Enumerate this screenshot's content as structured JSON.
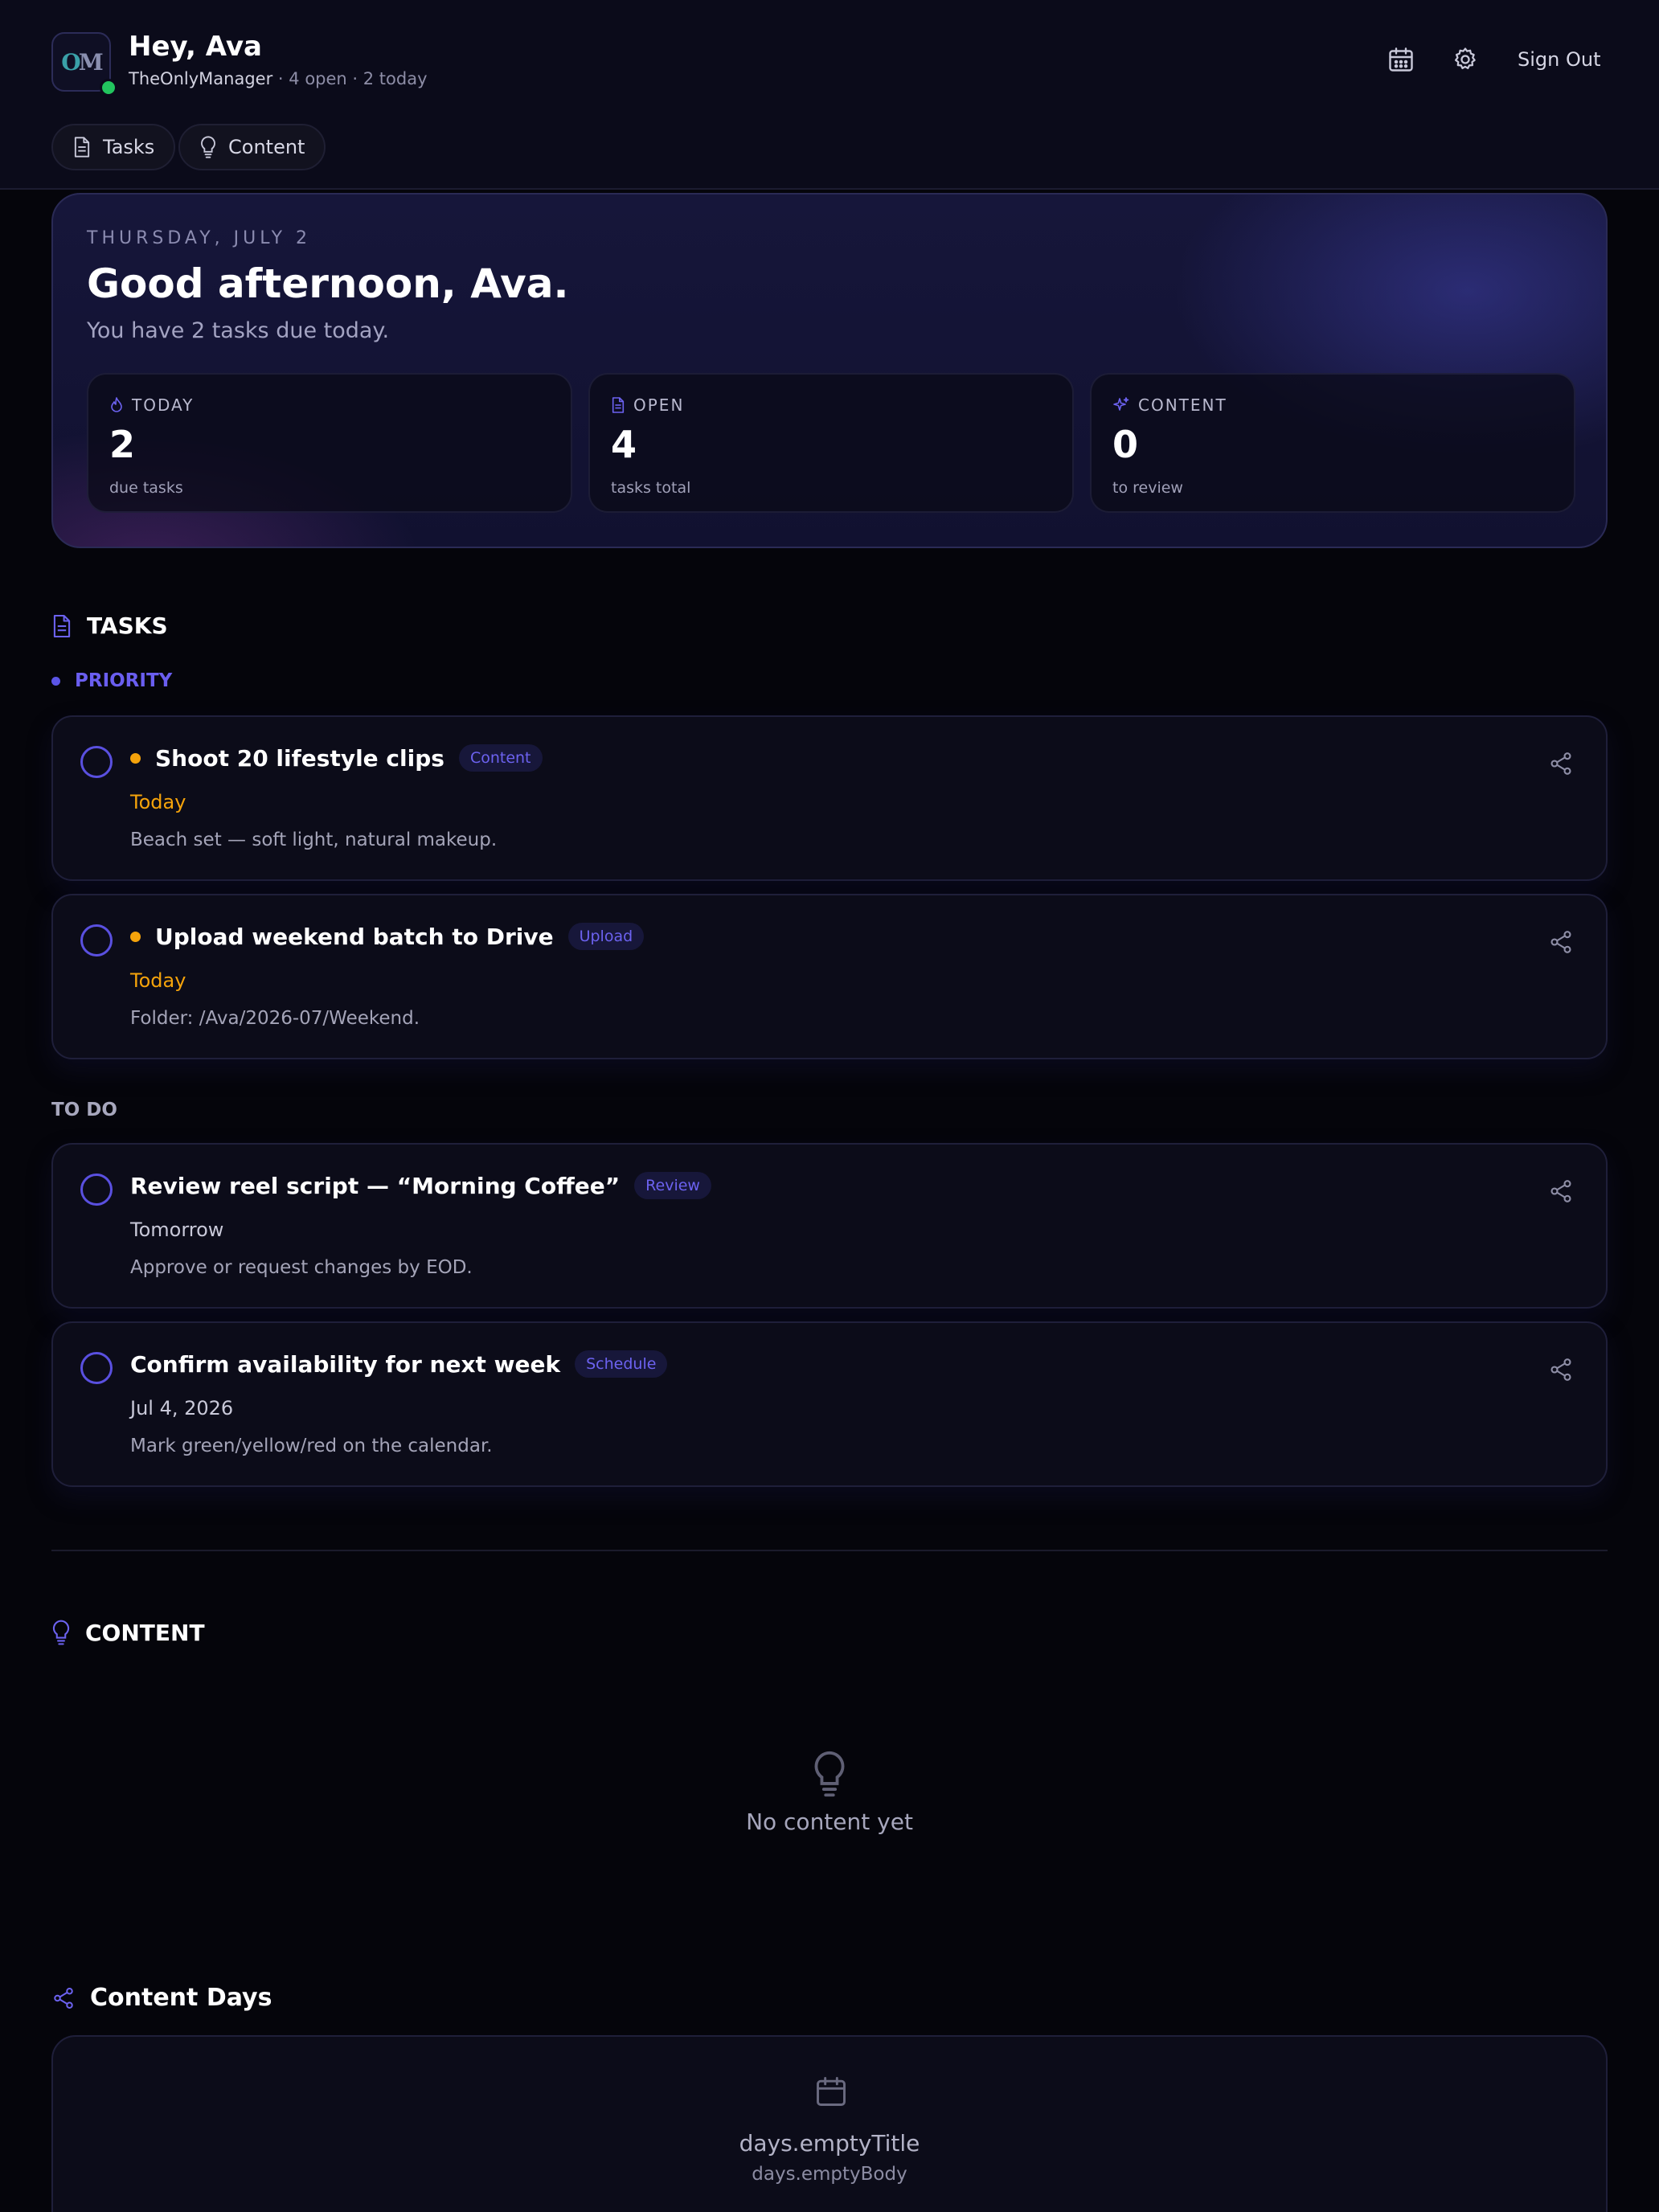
{
  "header": {
    "logo_text": "OM",
    "title": "Hey, Ava",
    "agency": "TheOnlyManager",
    "separator": "·",
    "stats": "4 open · 2 today",
    "sign_out": "Sign Out",
    "tabs": [
      {
        "label": "Tasks",
        "icon": "document-icon"
      },
      {
        "label": "Content",
        "icon": "lightbulb-icon"
      }
    ]
  },
  "hero": {
    "date": "THURSDAY, JULY 2",
    "title": "Good afternoon, Ava.",
    "subtitle": "You have 2 tasks due today.",
    "stats": [
      {
        "label": "TODAY",
        "value": "2",
        "caption": "due tasks",
        "icon": "flame-icon"
      },
      {
        "label": "OPEN",
        "value": "4",
        "caption": "tasks total",
        "icon": "document-icon"
      },
      {
        "label": "CONTENT",
        "value": "0",
        "caption": "to review",
        "icon": "sparkle-icon"
      }
    ]
  },
  "tasks": {
    "heading": "TASKS",
    "priority_label": "PRIORITY",
    "todo_label": "TO DO",
    "priority": [
      {
        "title": "Shoot 20 lifestyle clips",
        "tag": "Content",
        "due": "Today",
        "note": "Beach set — soft light, natural makeup."
      },
      {
        "title": "Upload weekend batch to Drive",
        "tag": "Upload",
        "due": "Today",
        "note": "Folder: /Ava/2026-07/Weekend."
      }
    ],
    "todo": [
      {
        "title": "Review reel script — “Morning Coffee”",
        "tag": "Review",
        "due": "Tomorrow",
        "note": "Approve or request changes by EOD."
      },
      {
        "title": "Confirm availability for next week",
        "tag": "Schedule",
        "due": "Jul 4, 2026",
        "note": "Mark green/yellow/red on the calendar."
      }
    ]
  },
  "content": {
    "heading": "CONTENT",
    "empty_title": "No content yet"
  },
  "content_days": {
    "heading": "Content Days",
    "empty_title": "days.emptyTitle",
    "empty_body": "days.emptyBody"
  },
  "colors": {
    "accent": "#5b55e6",
    "priority_dot": "#f5a30b",
    "online": "#22c55e",
    "background": "#05050b"
  }
}
